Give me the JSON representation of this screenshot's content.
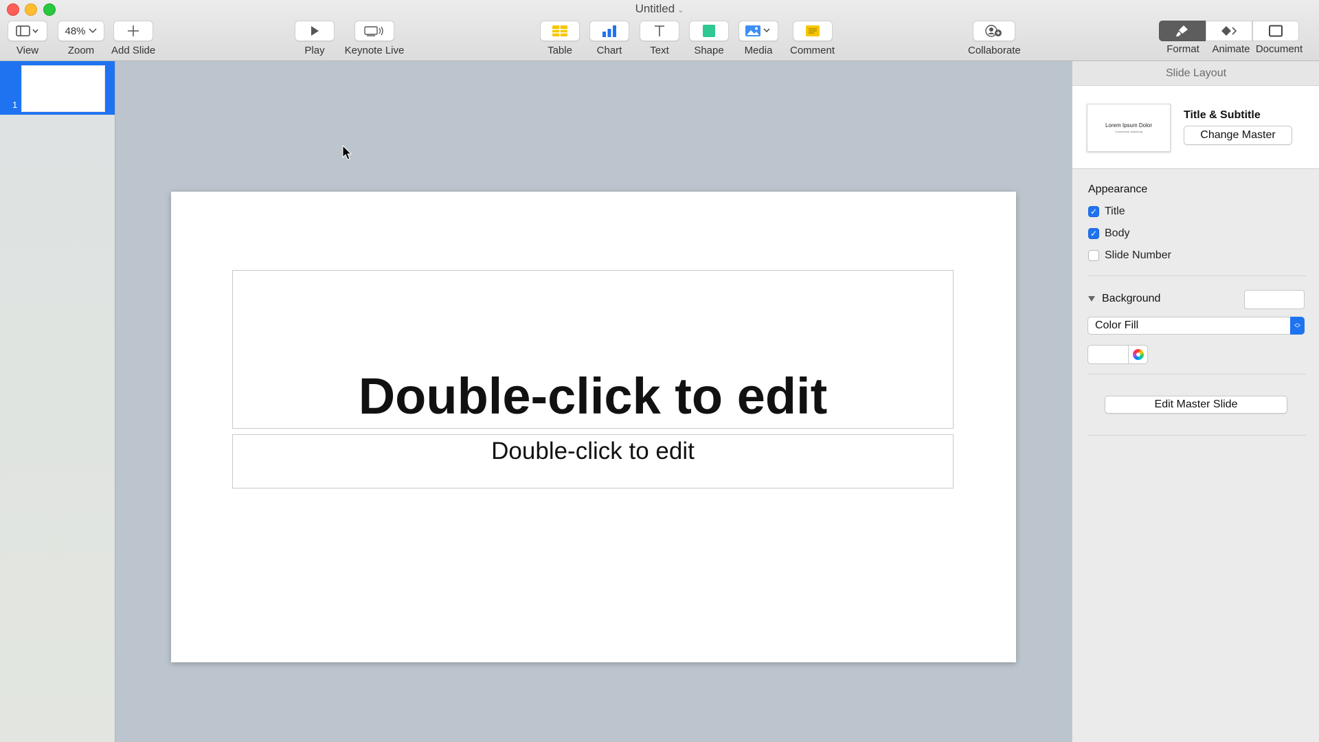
{
  "window": {
    "title": "Untitled"
  },
  "toolbar": {
    "view": "View",
    "zoom_value": "48%",
    "zoom": "Zoom",
    "add_slide": "Add Slide",
    "play": "Play",
    "keynote_live": "Keynote Live",
    "table": "Table",
    "chart": "Chart",
    "text": "Text",
    "shape": "Shape",
    "media": "Media",
    "comment": "Comment",
    "collaborate": "Collaborate",
    "format": "Format",
    "animate": "Animate",
    "document": "Document"
  },
  "navigator": {
    "slide_number": "1"
  },
  "slide": {
    "title_placeholder": "Double-click to edit",
    "subtitle_placeholder": "Double-click to edit"
  },
  "inspector": {
    "header": "Slide Layout",
    "layout_name": "Title & Subtitle",
    "thumb_title": "Lorem Ipsum Dolor",
    "thumb_subtitle": "Consectetur adipiscing",
    "change_master": "Change Master",
    "appearance_label": "Appearance",
    "checkboxes": [
      {
        "label": "Title",
        "checked": true
      },
      {
        "label": "Body",
        "checked": true
      },
      {
        "label": "Slide Number",
        "checked": false
      }
    ],
    "background_label": "Background",
    "fill_type": "Color Fill",
    "edit_master": "Edit Master Slide"
  },
  "colors": {
    "accent": "#1f73f0",
    "canvas": "#bcc5cd"
  }
}
